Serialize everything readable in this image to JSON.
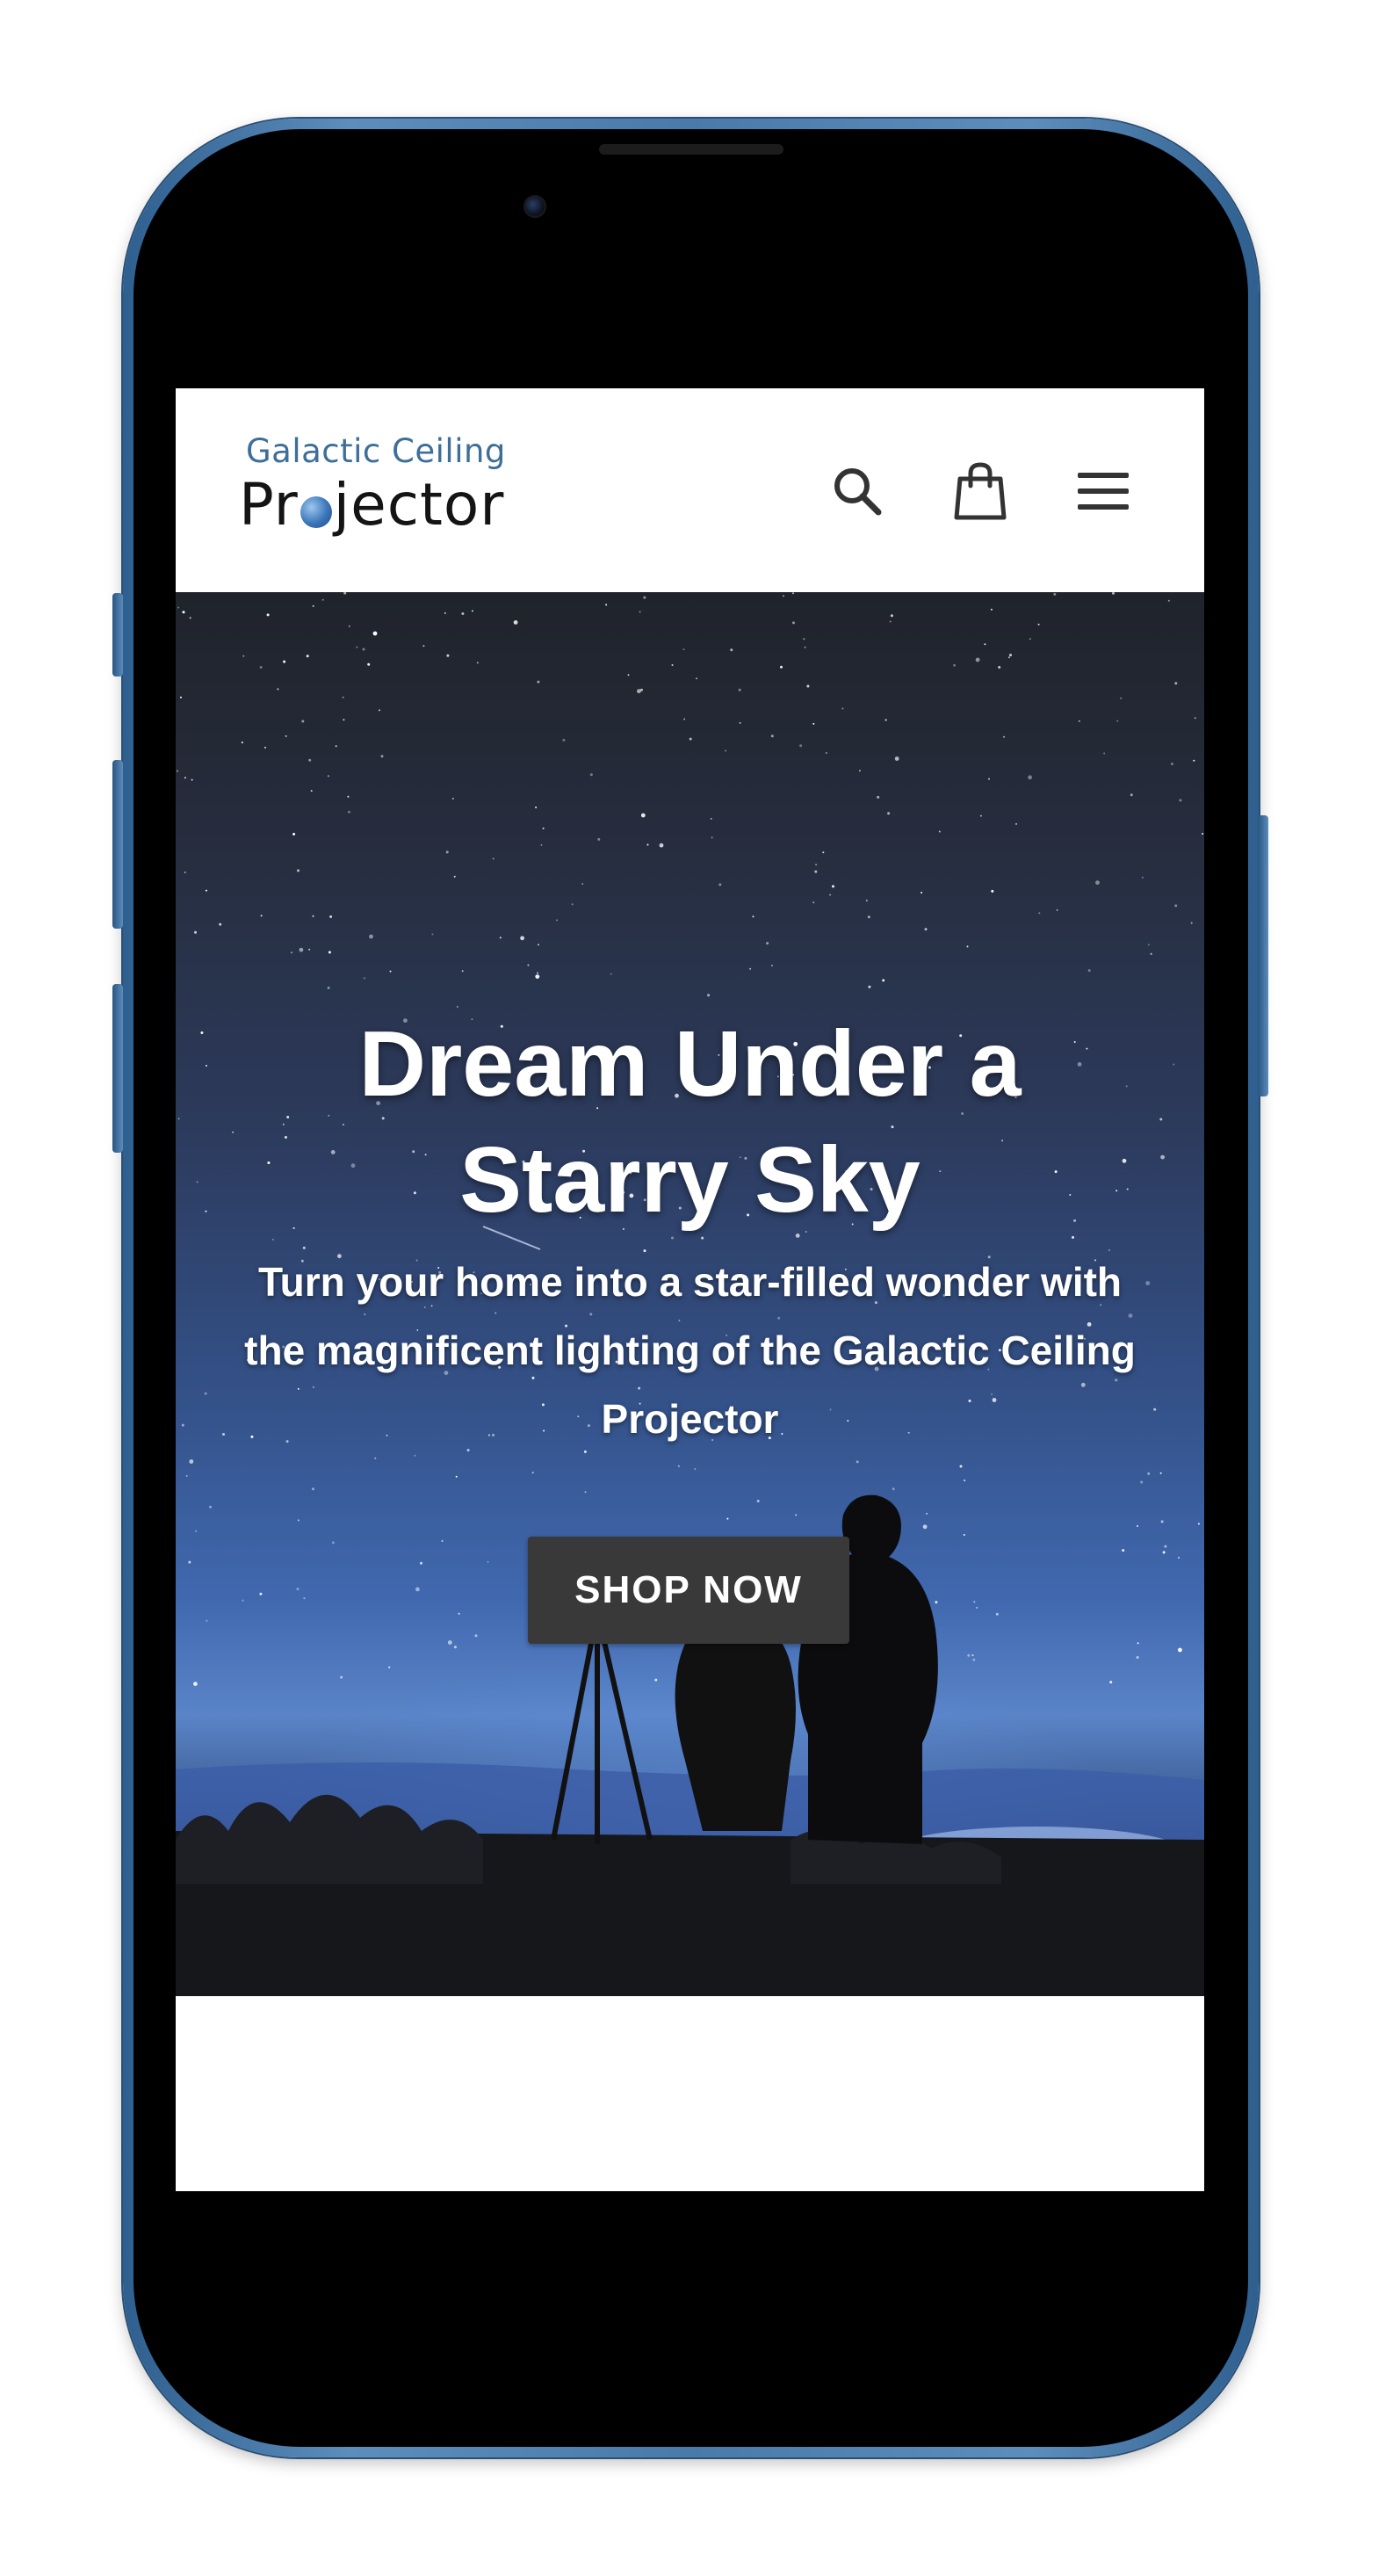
{
  "header": {
    "logo_top": "Galactic Ceiling",
    "logo_bottom_pre": "Pr",
    "logo_bottom_post": "jector",
    "icons": [
      "search-icon",
      "shopping-bag-icon",
      "menu-icon"
    ]
  },
  "hero": {
    "title": "Dream Under a Starry Sky",
    "subtitle": "Turn your home into a star-filled wonder with the magnificent lighting of the Galactic Ceiling Projector",
    "cta_label": "SHOP NOW"
  },
  "colors": {
    "frame": "#4a7aaa",
    "logo_accent": "#3d6f98",
    "button_bg": "#393939",
    "text_on_hero": "#ffffff"
  }
}
